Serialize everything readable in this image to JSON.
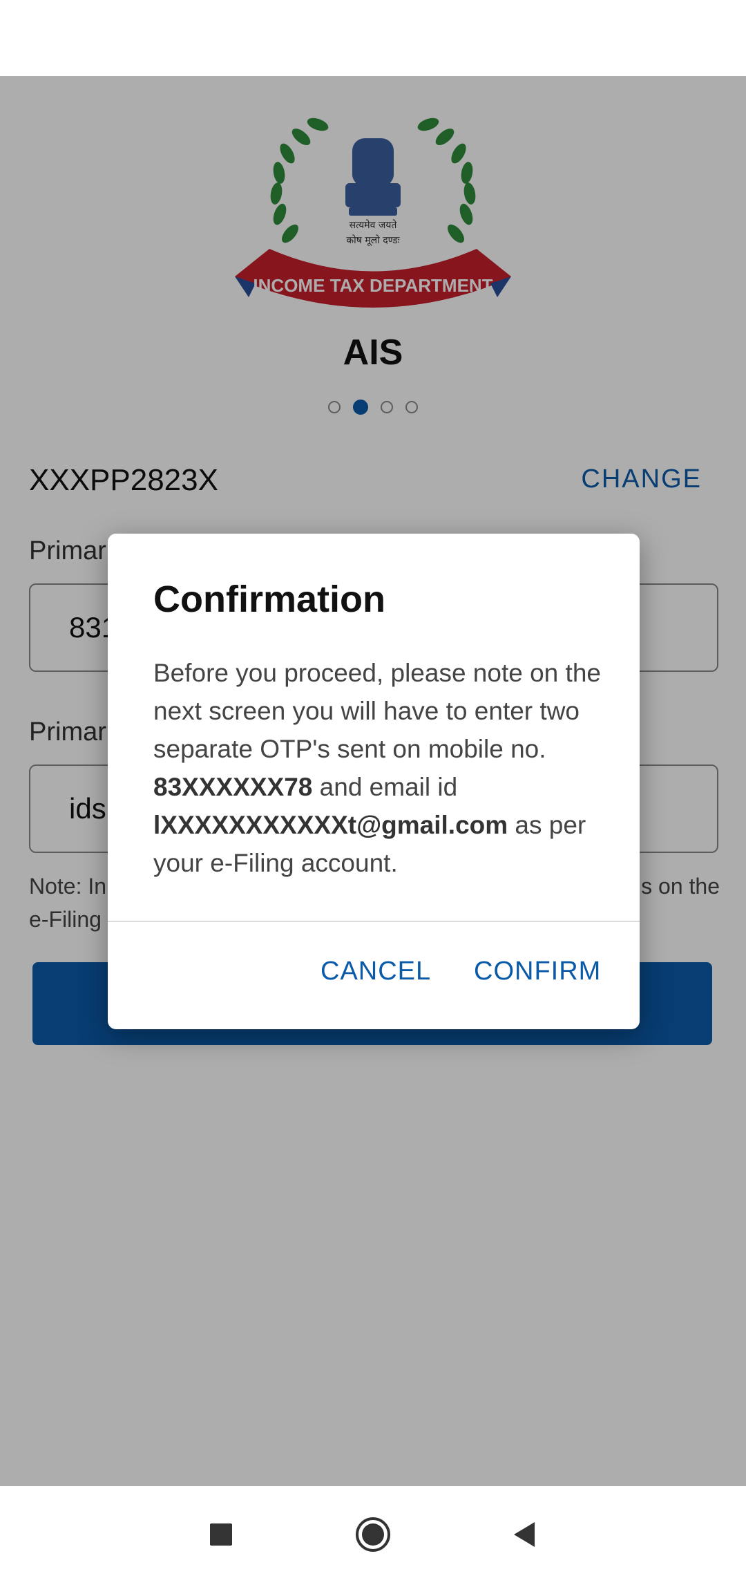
{
  "app": {
    "title": "AIS",
    "pan": "XXXPP2823X",
    "change_label": "CHANGE",
    "mobile_label": "Primar",
    "mobile_value": "831",
    "email_label": "Primar",
    "email_value": "ids",
    "note_line1_left": "Note: In",
    "note_line1_right": "s on the",
    "note_line2_left": "e-Filing",
    "logo_text": "INCOME TAX DEPARTMENT",
    "accent_color": "#0b5aa8"
  },
  "dialog": {
    "title": "Confirmation",
    "body_1": "Before you proceed, please note on the next screen you will have to enter two separate OTP's sent on mobile no. ",
    "mobile_masked": "83XXXXXX78",
    "body_2": " and email id ",
    "email_masked": "lXXXXXXXXXXXt@gmail.com",
    "body_3": " as per your e-Filing account.",
    "cancel_label": "CANCEL",
    "confirm_label": "CONFIRM"
  },
  "nav": {
    "icons": [
      "recents-square-icon",
      "home-circle-icon",
      "back-triangle-icon"
    ]
  }
}
